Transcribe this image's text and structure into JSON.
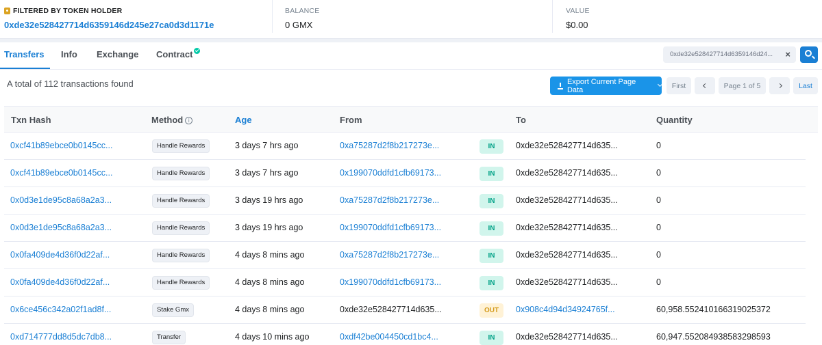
{
  "summary": {
    "filter_label": "FILTERED BY TOKEN HOLDER",
    "holder_address": "0xde32e528427714d6359146d245e27ca0d3d1171e",
    "balance_label": "BALANCE",
    "balance_value": "0 GMX",
    "value_label": "VALUE",
    "value_value": "$0.00"
  },
  "tabs": [
    {
      "label": "Transfers",
      "active": true
    },
    {
      "label": "Info"
    },
    {
      "label": "Exchange"
    },
    {
      "label": "Contract"
    }
  ],
  "search": {
    "value": "0xde32e528427714d6359146d24..."
  },
  "toolbar": {
    "total_text": "A total of 112 transactions found",
    "export_label": "Export Current Page Data",
    "first_label": "First",
    "page_label": "Page 1 of 5",
    "last_label": "Last"
  },
  "table": {
    "headers": {
      "txn_hash": "Txn Hash",
      "method": "Method",
      "age": "Age",
      "from": "From",
      "to": "To",
      "quantity": "Quantity"
    },
    "rows": [
      {
        "hash": "0xcf41b89ebce0b0145cc...",
        "method": "Handle Rewards",
        "age": "3 days 7 hrs ago",
        "from": "0xa75287d2f8b217273e...",
        "dir": "IN",
        "to": "0xde32e528427714d635...",
        "qty": "0"
      },
      {
        "hash": "0xcf41b89ebce0b0145cc...",
        "method": "Handle Rewards",
        "age": "3 days 7 hrs ago",
        "from": "0x199070ddfd1cfb69173...",
        "dir": "IN",
        "to": "0xde32e528427714d635...",
        "qty": "0"
      },
      {
        "hash": "0x0d3e1de95c8a68a2a3...",
        "method": "Handle Rewards",
        "age": "3 days 19 hrs ago",
        "from": "0xa75287d2f8b217273e...",
        "dir": "IN",
        "to": "0xde32e528427714d635...",
        "qty": "0"
      },
      {
        "hash": "0x0d3e1de95c8a68a2a3...",
        "method": "Handle Rewards",
        "age": "3 days 19 hrs ago",
        "from": "0x199070ddfd1cfb69173...",
        "dir": "IN",
        "to": "0xde32e528427714d635...",
        "qty": "0"
      },
      {
        "hash": "0x0fa409de4d36f0d22af...",
        "method": "Handle Rewards",
        "age": "4 days 8 mins ago",
        "from": "0xa75287d2f8b217273e...",
        "dir": "IN",
        "to": "0xde32e528427714d635...",
        "qty": "0"
      },
      {
        "hash": "0x0fa409de4d36f0d22af...",
        "method": "Handle Rewards",
        "age": "4 days 8 mins ago",
        "from": "0x199070ddfd1cfb69173...",
        "dir": "IN",
        "to": "0xde32e528427714d635...",
        "qty": "0"
      },
      {
        "hash": "0x6ce456c342a02f1ad8f...",
        "method": "Stake Gmx",
        "age": "4 days 8 mins ago",
        "from": "0xde32e528427714d635...",
        "dir": "OUT",
        "to": "0x908c4d94d34924765f...",
        "qty": "60,958.552410166319025372"
      },
      {
        "hash": "0xd714777dd8d5dc7db8...",
        "method": "Transfer",
        "age": "4 days 10 mins ago",
        "from": "0xdf42be004450cd1bc4...",
        "dir": "IN",
        "to": "0xde32e528427714d635...",
        "qty": "60,947.552084938583298593"
      }
    ]
  }
}
